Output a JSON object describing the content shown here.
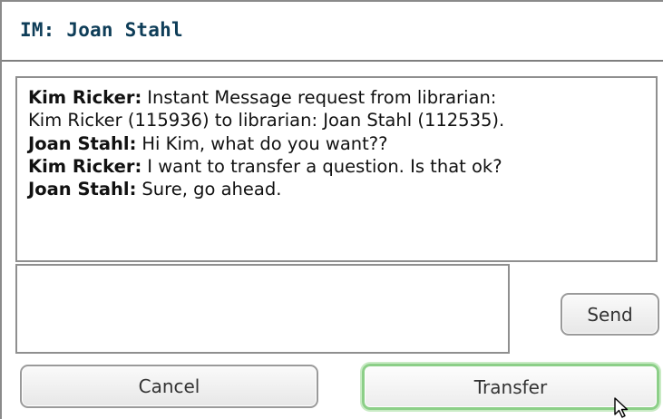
{
  "window": {
    "title": "IM: Joan Stahl"
  },
  "transcript": {
    "messages": [
      {
        "sender": "Kim Ricker:",
        "text": "Instant Message request from librarian:"
      },
      {
        "sender": "",
        "text": "Kim Ricker (115936) to librarian: Joan Stahl (112535)."
      },
      {
        "sender": "Joan Stahl:",
        "text": "Hi Kim,  what do you want??"
      },
      {
        "sender": "Kim Ricker:",
        "text": "I want to transfer a question.  Is that ok?"
      },
      {
        "sender": "Joan Stahl:",
        "text": "Sure, go ahead."
      }
    ]
  },
  "compose": {
    "value": ""
  },
  "buttons": {
    "send_label": "Send",
    "cancel_label": "Cancel",
    "transfer_label": "Transfer"
  },
  "colors": {
    "title_text": "#0e3d58",
    "transfer_focus_border": "#8ccf88"
  },
  "icons": {
    "cursor": "mouse-pointer-arrow-icon"
  }
}
